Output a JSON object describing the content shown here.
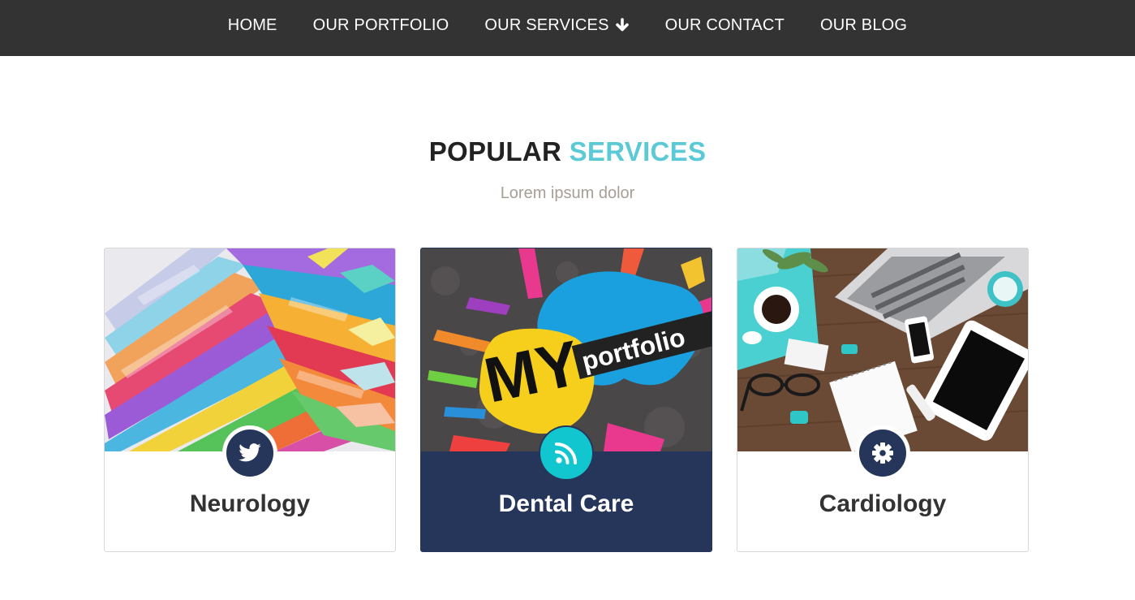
{
  "nav": {
    "items": [
      {
        "label": "HOME"
      },
      {
        "label": "OUR PORTFOLIO"
      },
      {
        "label": "OUR SERVICES"
      },
      {
        "label": "OUR CONTACT"
      },
      {
        "label": "OUR BLOG"
      }
    ]
  },
  "section": {
    "title_main": "POPULAR",
    "title_accent": "SERVICES",
    "subtitle": "Lorem ipsum dolor"
  },
  "cards": [
    {
      "title": "Neurology",
      "icon": "twitter-icon"
    },
    {
      "title": "Dental Care",
      "icon": "rss-icon",
      "image_text": "MY portfolio"
    },
    {
      "title": "Cardiology",
      "icon": "gear-icon"
    }
  ],
  "colors": {
    "nav_bg": "#333333",
    "accent": "#5bcad6",
    "navy": "#26365a",
    "teal": "#12c6cf",
    "subtitle": "#a79f95"
  }
}
